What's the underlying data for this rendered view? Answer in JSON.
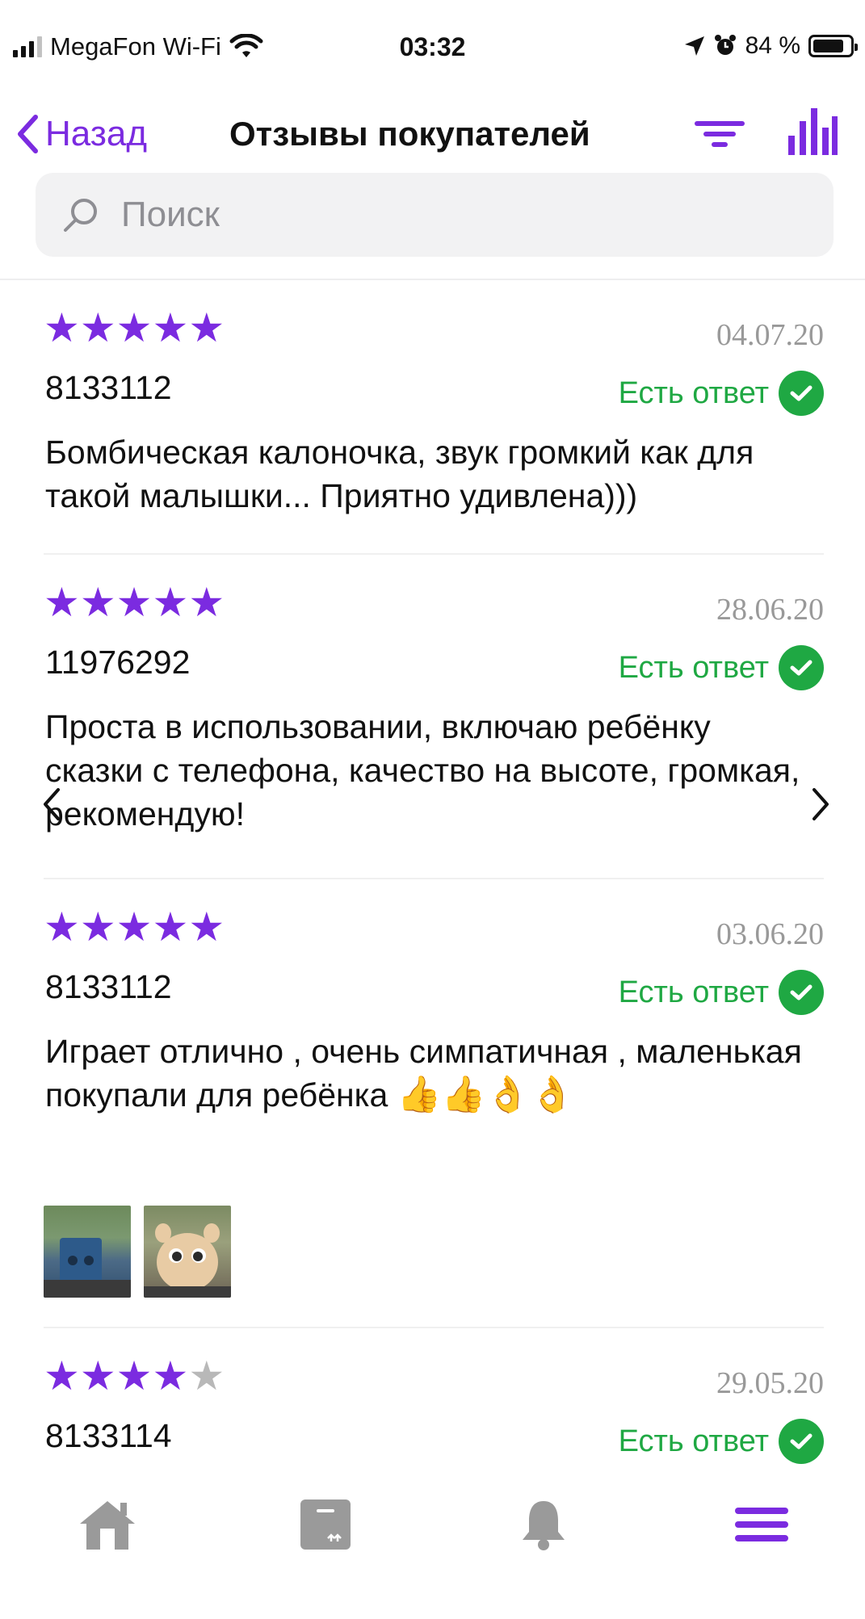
{
  "status_bar": {
    "carrier": "MegaFon Wi-Fi",
    "time": "03:32",
    "battery": "84 %",
    "battery_level": 0.84
  },
  "nav": {
    "back_label": "Назад",
    "title": "Отзывы покупателей",
    "accent_color": "#7b2be0"
  },
  "search": {
    "placeholder": "Поиск"
  },
  "reviews": [
    {
      "rating": 5,
      "date": "04.07.20",
      "author": "8133112",
      "answer_label": "Есть ответ",
      "text": "Бомбическая калоночка, звук громкий как для такой малышки... Приятно удивлена)))"
    },
    {
      "rating": 5,
      "date": "28.06.20",
      "author": "11976292",
      "answer_label": "Есть ответ",
      "text": "Проста в использовании, включаю ребёнку сказки с телефона, качество на высоте, громкая, рекомендую!"
    },
    {
      "rating": 5,
      "date": "03.06.20",
      "author": "8133112",
      "answer_label": "Есть ответ",
      "text": "Играет отлично , очень симпатичная , маленькая покупали для ребёнка"
    },
    {
      "rating": 4,
      "date": "29.05.20",
      "author": "8133114",
      "answer_label": "Есть ответ",
      "text": ""
    }
  ],
  "colors": {
    "star_filled": "#7b2be0",
    "star_empty": "#b8b8b8",
    "answer_green": "#1fa843"
  },
  "tabbar": {
    "icons": [
      "home-icon",
      "box-icon",
      "bell-icon",
      "menu-icon"
    ]
  }
}
